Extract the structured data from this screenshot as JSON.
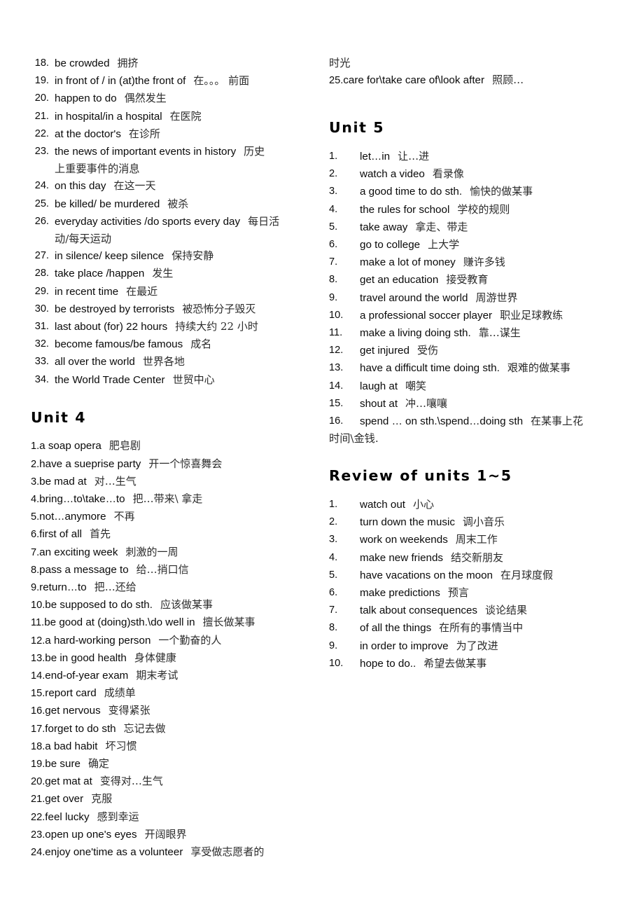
{
  "document": {
    "type": "vocabulary-phrase-list",
    "language_pair": "English-Chinese"
  },
  "left_column": {
    "unit3_continued": {
      "list_style": "hanging-number",
      "items": [
        {
          "num": "18.",
          "en": "be crowded",
          "zh": "拥挤"
        },
        {
          "num": "19.",
          "en": "in front of / in (at)the front of",
          "zh": "在。。。 前面"
        },
        {
          "num": "20.",
          "en": "happen to do",
          "zh": "偶然发生"
        },
        {
          "num": "21.",
          "en": "in hospital/in a hospital",
          "zh": "在医院"
        },
        {
          "num": "22.",
          "en": "at the doctor's",
          "zh": "在诊所"
        },
        {
          "num": "23.",
          "en": "the news of important events in history",
          "zh": "历史",
          "zh_wrap": "上重要事件的消息"
        },
        {
          "num": "24.",
          "en": "on this day",
          "zh": "在这一天"
        },
        {
          "num": "25.",
          "en": "be killed/ be murdered",
          "zh": "被杀"
        },
        {
          "num": "26.",
          "en": "everyday activities /do sports every day",
          "zh": "每日活",
          "zh_wrap": "动/每天运动"
        },
        {
          "num": "27.",
          "en": "in silence/ keep silence",
          "zh": "保持安静"
        },
        {
          "num": "28.",
          "en": "take place /happen",
          "zh": "发生"
        },
        {
          "num": "29.",
          "en": "in recent time",
          "zh": "在最近"
        },
        {
          "num": "30.",
          "en": "be destroyed by terrorists",
          "zh": "被恐怖分子毁灭"
        },
        {
          "num": "31.",
          "en": "last about (for) 22 hours",
          "zh": "持续大约 22 小时"
        },
        {
          "num": "32.",
          "en": "become famous/be famous",
          "zh": "成名"
        },
        {
          "num": "33.",
          "en": "all over the world",
          "zh": "世界各地"
        },
        {
          "num": "34.",
          "en": "the World Trade Center",
          "zh": "世贸中心"
        }
      ]
    },
    "unit4": {
      "heading": "Unit 4",
      "list_style": "flush-inline-number",
      "items": [
        {
          "num": "1.",
          "en": "a soap opera",
          "zh": "肥皂剧"
        },
        {
          "num": "2.",
          "en": "have a sueprise party",
          "zh": "开一个惊喜舞会"
        },
        {
          "num": "3.",
          "en": "be mad at",
          "zh": "对…生气"
        },
        {
          "num": "4.",
          "en": "bring…to\\take…to",
          "zh": "把…带来\\ 拿走"
        },
        {
          "num": "5.",
          "en": "not…anymore",
          "zh": "不再"
        },
        {
          "num": "6.",
          "en": "first of all",
          "zh": "首先"
        },
        {
          "num": "7.",
          "en": "an exciting week",
          "zh": "刺激的一周"
        },
        {
          "num": "8.",
          "en": "pass a message to",
          "zh": "给…捎口信"
        },
        {
          "num": "9.",
          "en": "return…to",
          "zh": "把…还给"
        },
        {
          "num": "10.",
          "en": "be supposed to do sth.",
          "zh": "应该做某事"
        },
        {
          "num": "11.",
          "en": "be good at (doing)sth.\\do well in",
          "zh": "擅长做某事"
        },
        {
          "num": "12.",
          "en": "a hard-working person",
          "zh": "一个勤奋的人"
        },
        {
          "num": "13.",
          "en": "be in good health",
          "zh": "身体健康"
        },
        {
          "num": "14.",
          "en": "end-of-year exam",
          "zh": "期末考试"
        },
        {
          "num": "15.",
          "en": "report card",
          "zh": "成绩单"
        },
        {
          "num": "16.",
          "en": "get nervous",
          "zh": "变得紧张"
        },
        {
          "num": "17.",
          "en": "forget to do sth",
          "zh": "忘记去做"
        },
        {
          "num": "18.",
          "en": "a bad habit",
          "zh": "坏习惯"
        },
        {
          "num": "19.",
          "en": "be sure",
          "zh": "确定"
        },
        {
          "num": "20.",
          "en": "get mat at",
          "zh": "变得对…生气"
        },
        {
          "num": "21.",
          "en": "get over",
          "zh": "克服"
        },
        {
          "num": "22.",
          "en": "feel lucky",
          "zh": "感到幸运"
        },
        {
          "num": "23.",
          "en": "open up one's eyes",
          "zh": "开阔眼界"
        },
        {
          "num": "24.",
          "en": "enjoy one'time as a volunteer",
          "zh": "享受做志愿者的"
        }
      ]
    }
  },
  "right_column": {
    "unit4_overflow": {
      "wrap_text": "时光",
      "items": [
        {
          "num": "25.",
          "en": "care for\\take care of\\look after",
          "zh": "照顾…"
        }
      ]
    },
    "unit5": {
      "heading": "Unit 5",
      "list_style": "wide-number",
      "items": [
        {
          "num": "1.",
          "en": "let…in",
          "zh": "让…进"
        },
        {
          "num": "2.",
          "en": "watch a video",
          "zh": "看录像"
        },
        {
          "num": "3.",
          "en": "a good time to do sth.",
          "zh": "愉快的做某事"
        },
        {
          "num": "4.",
          "en": "the rules for school",
          "zh": "学校的规则"
        },
        {
          "num": "5.",
          "en": "take away",
          "zh": "拿走、带走"
        },
        {
          "num": "6.",
          "en": "go to college",
          "zh": "上大学"
        },
        {
          "num": "7.",
          "en": "make a lot of money",
          "zh": "赚许多钱"
        },
        {
          "num": "8.",
          "en": "get an education",
          "zh": "接受教育"
        },
        {
          "num": "9.",
          "en": "travel around the world",
          "zh": "周游世界"
        },
        {
          "num": "10.",
          "en": "a professional soccer player",
          "zh": "职业足球教练"
        },
        {
          "num": "11.",
          "en": "make a living doing sth.",
          "zh": "靠…谋生"
        },
        {
          "num": "12.",
          "en": "get injured",
          "zh": "受伤"
        },
        {
          "num": "13.",
          "en": "have a difficult time doing sth.",
          "zh": "艰难的做某事"
        },
        {
          "num": "14.",
          "en": "laugh at",
          "zh": "嘲笑"
        },
        {
          "num": "15.",
          "en": "shout at",
          "zh": "冲…嚷嚷"
        },
        {
          "num": "16.",
          "en": "spend … on sth.\\spend…doing sth",
          "zh": "在某事上花",
          "zh_wrap": "时间\\金钱."
        }
      ]
    },
    "review": {
      "heading": "Review of units 1~5",
      "list_style": "wide-number",
      "items": [
        {
          "num": "1.",
          "en": "watch out",
          "zh": "小心"
        },
        {
          "num": "2.",
          "en": "turn down the music",
          "zh": "调小音乐"
        },
        {
          "num": "3.",
          "en": "work on weekends",
          "zh": "周末工作"
        },
        {
          "num": "4.",
          "en": "make new friends",
          "zh": "结交新朋友"
        },
        {
          "num": "5.",
          "en": "have vacations on the moon",
          "zh": "在月球度假"
        },
        {
          "num": "6.",
          "en": "make predictions",
          "zh": "预言"
        },
        {
          "num": "7.",
          "en": "talk about consequences",
          "zh": "谈论结果"
        },
        {
          "num": "8.",
          "en": "of all the things",
          "zh": "在所有的事情当中"
        },
        {
          "num": "9.",
          "en": "in order to improve",
          "zh": "为了改进"
        },
        {
          "num": "10.",
          "en": "hope to do..",
          "zh": "希望去做某事"
        }
      ]
    }
  }
}
